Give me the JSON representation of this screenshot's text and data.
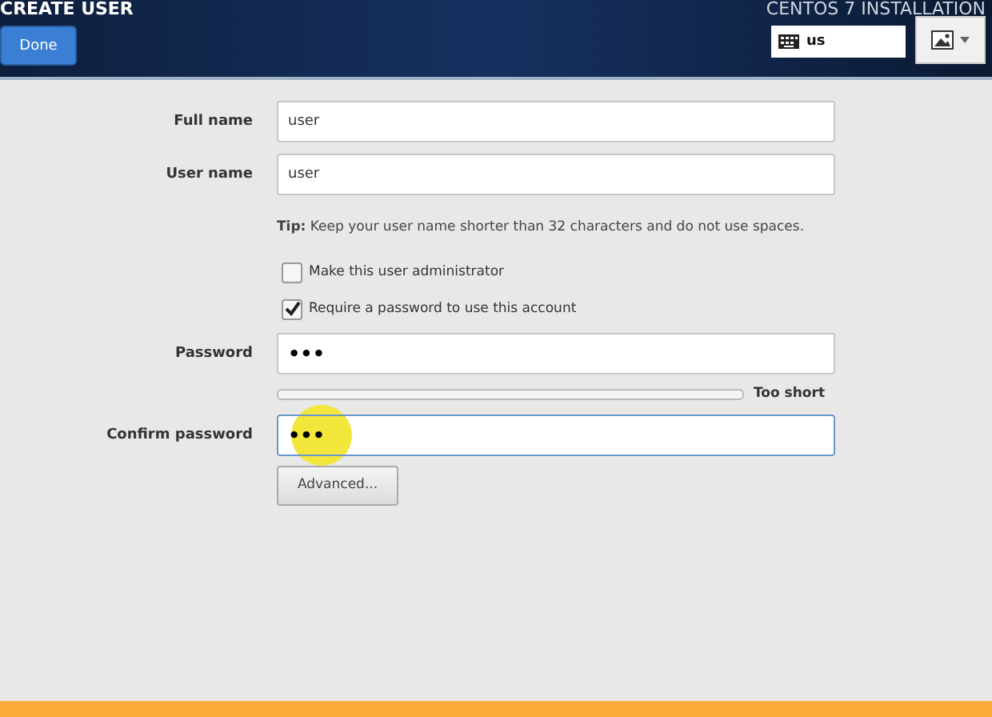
{
  "header": {
    "title": "CREATE USER",
    "done_button": "Done",
    "product": "CENTOS 7 INSTALLATION",
    "keyboard_layout": "us"
  },
  "form": {
    "fields": [
      {
        "label": "Full name",
        "value": "user",
        "focused": false
      },
      {
        "label": "User name",
        "value": "user",
        "focused": false
      }
    ],
    "tip": "**Tip:** Keep your user name shorter than 32 characters and do not use spaces.",
    "checkboxes": [
      {
        "label": "Make this user administrator",
        "checked": false
      },
      {
        "label": "Require a password to use this account",
        "checked": true
      }
    ],
    "password": {
      "label": "Password",
      "value": "•••",
      "focused": false
    },
    "strength": {
      "level": 0,
      "reading": "Too short"
    },
    "confirm": {
      "label": "Confirm password",
      "value": "•••",
      "focused": true
    },
    "advanced_button": "Advanced..."
  }
}
